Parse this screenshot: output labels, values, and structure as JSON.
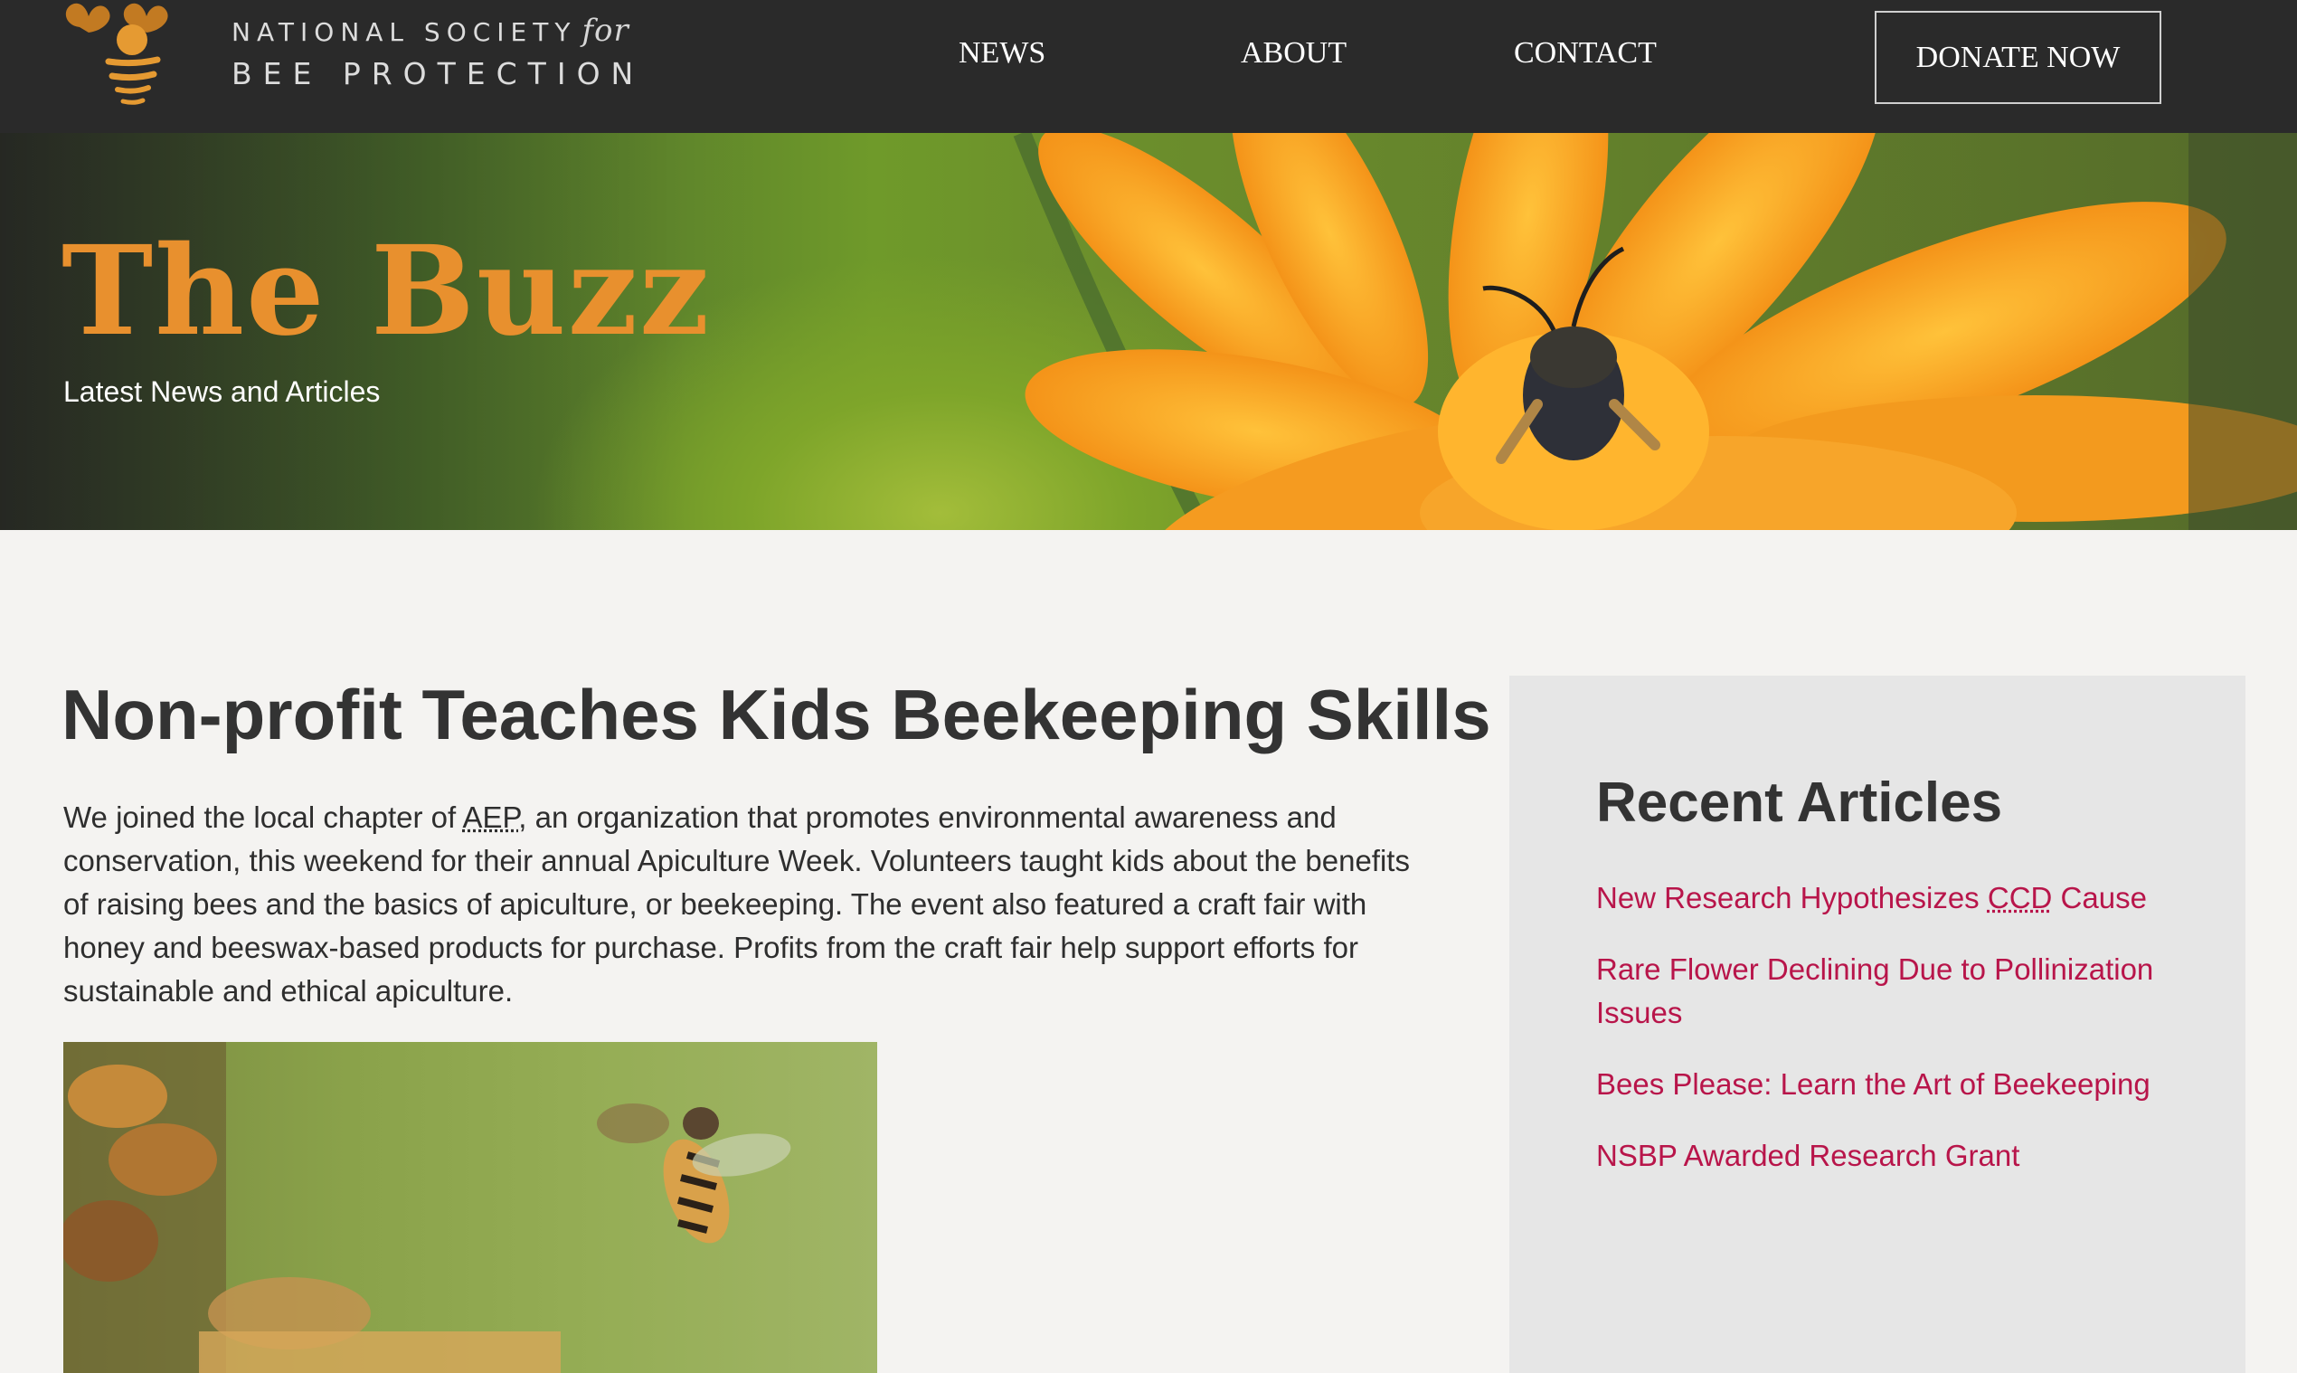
{
  "colors": {
    "nav_bg": "#2a2a2a",
    "accent_orange": "#e8902e",
    "link_crimson": "#b8154a",
    "page_bg": "#f4f3f1",
    "sidebar_bg": "#e6e6e6"
  },
  "header": {
    "logo": {
      "line1": "NATIONAL SOCIETY",
      "line1_italic": "for",
      "line2": "BEE PROTECTION",
      "icon": "bee-logo-icon"
    },
    "nav": {
      "news": "NEWS",
      "about": "ABOUT",
      "contact": "CONTACT"
    },
    "donate_label": "DONATE NOW"
  },
  "hero": {
    "title": "The Buzz",
    "subtitle": "Latest News and Articles"
  },
  "article": {
    "title": "Non-profit Teaches Kids Beekeeping Skills",
    "body_before": "We joined the local chapter of ",
    "abbr": "AEP",
    "body_after": ", an organization that promotes environmental awareness and conservation, this weekend for their annual Apiculture Week. Volunteers taught kids about the benefits of raising bees and the basics of apiculture, or beekeeping. The event also featured a craft fair with honey and beeswax-based products for purchase. Profits from the craft fair help support efforts for sustainable and ethical apiculture."
  },
  "sidebar": {
    "title": "Recent Articles",
    "items": [
      {
        "before": "New Research Hypothesizes ",
        "abbr": "CCD",
        "after": " Cause"
      },
      {
        "label": "Rare Flower Declining Due to Pollinization Issues"
      },
      {
        "label": "Bees Please: Learn the Art of Beekeeping"
      },
      {
        "label": "NSBP Awarded Research Grant"
      }
    ]
  }
}
